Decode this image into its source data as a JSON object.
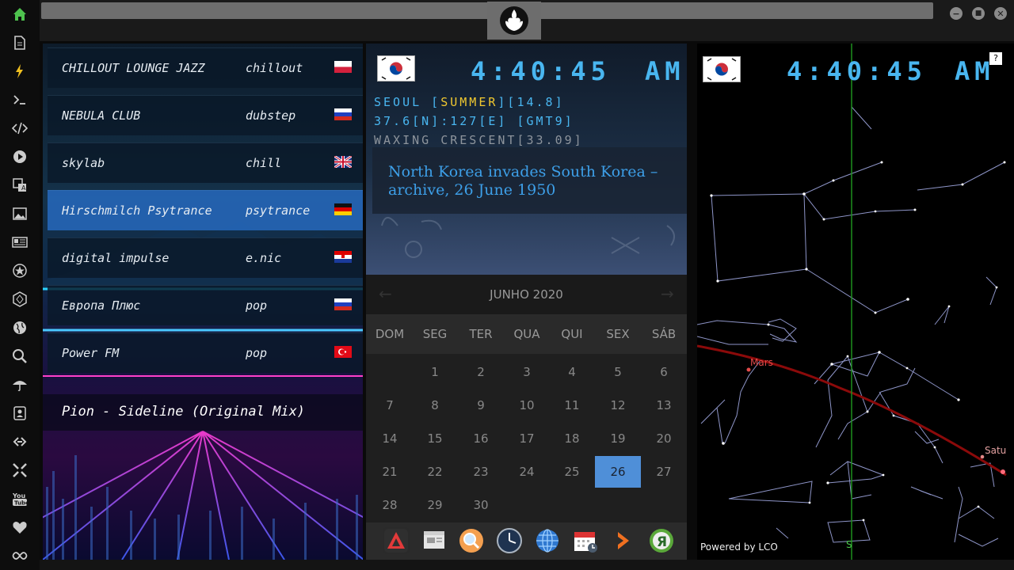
{
  "sidebar": {
    "icons": [
      "home-icon",
      "document-icon",
      "lightning-icon",
      "terminal-icon",
      "code-icon",
      "play-icon",
      "translate-icon",
      "image-icon",
      "news-icon",
      "settings-star-icon",
      "hexagon-icon",
      "globe-icon",
      "search-icon",
      "umbrella-icon",
      "contact-card-icon",
      "link-icon",
      "expand-icon",
      "youtube-icon",
      "heart-icon",
      "infinity-icon"
    ]
  },
  "window": {
    "minimize": "−",
    "maximize": "■",
    "close": "✕"
  },
  "radio": {
    "stations": [
      {
        "name": "CHILLOUT LOUNGE JAZZ",
        "genre": "chillout",
        "flag": "poland"
      },
      {
        "name": "NEBULA CLUB",
        "genre": "dubstep",
        "flag": "russia"
      },
      {
        "name": "skylab",
        "genre": "chill",
        "flag": "uk"
      },
      {
        "name": "Hirschmilch Psytrance",
        "genre": "psytrance",
        "flag": "germany"
      },
      {
        "name": "digital impulse",
        "genre": "e.nic",
        "flag": "croatia"
      },
      {
        "name": "Европа Плюс",
        "genre": "pop",
        "flag": "russia"
      },
      {
        "name": "Power FM",
        "genre": "pop",
        "flag": "turkey"
      }
    ],
    "active_index": 3,
    "now_playing": "Pion - Sideline (Original Mix)"
  },
  "clock": {
    "time": "4:40:45",
    "ampm": "AM",
    "city_line_prefix": "SEOUL [",
    "season": "SUMMER",
    "city_line_suffix": "][14.8]",
    "coords": "37.6[N]:127[E] [GMT9]",
    "moon": "WAXING CRESCENT[33.09]",
    "news": "North Korea invades South Korea – archive, 26 June 1950"
  },
  "calendar": {
    "title": "JUNHO 2020",
    "prev": "←",
    "next": "→",
    "days_of_week": [
      "DOM",
      "SEG",
      "TER",
      "QUA",
      "QUI",
      "SEX",
      "SÁB"
    ],
    "weeks": [
      [
        "",
        "1",
        "2",
        "3",
        "4",
        "5",
        "6"
      ],
      [
        "7",
        "8",
        "9",
        "10",
        "11",
        "12",
        "13"
      ],
      [
        "14",
        "15",
        "16",
        "17",
        "18",
        "19",
        "20"
      ],
      [
        "21",
        "22",
        "23",
        "24",
        "25",
        "26",
        "27"
      ],
      [
        "28",
        "29",
        "30",
        "",
        "",
        "",
        ""
      ]
    ],
    "today": "26"
  },
  "dock": {
    "apps": [
      "anydesk-icon",
      "notes-icon",
      "magnifier-icon",
      "clock-icon",
      "globe-browser-icon",
      "calendar-icon",
      "arrow-right-icon",
      "yandex-icon"
    ]
  },
  "sky": {
    "time": "4:40:45",
    "ampm": "AM",
    "help": "?",
    "planets": [
      "Mars",
      "Satu"
    ],
    "direction": "S",
    "powered": "Powered by LCO"
  },
  "colors": {
    "lcd_blue": "#49b6f0",
    "highlight_yellow": "#f0c830",
    "news_blue": "#3d9fe8",
    "today_blue": "#4f8fd8",
    "ecliptic_red": "#8b0a0a",
    "meridian_green": "#1e8f1e"
  }
}
